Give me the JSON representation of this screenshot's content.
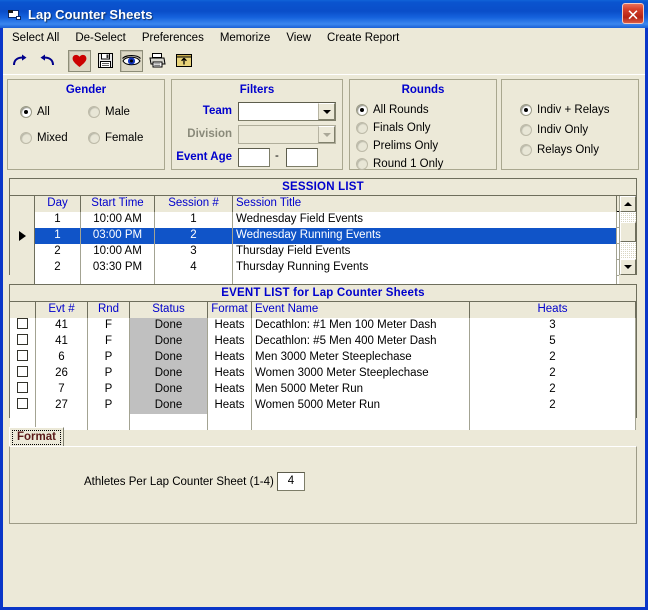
{
  "window": {
    "title": "Lap Counter Sheets",
    "close_label": "✕"
  },
  "menubar": {
    "items": [
      {
        "label": "Select All"
      },
      {
        "label": "De-Select"
      },
      {
        "label": "Preferences"
      },
      {
        "label": "Memorize"
      },
      {
        "label": "View"
      },
      {
        "label": "Create Report"
      }
    ]
  },
  "toolbar": {
    "buttons": [
      {
        "icon": "redo-arrow-icon",
        "pressed": false
      },
      {
        "icon": "undo-arrow-icon",
        "pressed": false
      },
      {
        "icon": "heart-icon",
        "pressed": true
      },
      {
        "icon": "save-floppy-icon",
        "pressed": false
      },
      {
        "icon": "eye-preview-icon",
        "pressed": true
      },
      {
        "icon": "printer-icon",
        "pressed": false
      },
      {
        "icon": "folder-up-icon",
        "pressed": false
      }
    ]
  },
  "gender": {
    "title": "Gender",
    "options": [
      {
        "label": "All",
        "selected": true
      },
      {
        "label": "Male",
        "selected": false
      },
      {
        "label": "Mixed",
        "selected": false
      },
      {
        "label": "Female",
        "selected": false
      }
    ]
  },
  "filters": {
    "title": "Filters",
    "team_label": "Team",
    "team_value": "",
    "division_label": "Division",
    "division_value": "",
    "division_disabled": true,
    "event_age_label": "Event Age",
    "event_age_from": "",
    "event_age_to": "",
    "event_age_separator": "-"
  },
  "rounds": {
    "title": "Rounds",
    "options": [
      {
        "label": "All Rounds",
        "selected": true
      },
      {
        "label": "Finals Only",
        "selected": false
      },
      {
        "label": "Prelims Only",
        "selected": false
      },
      {
        "label": "Round 1 Only",
        "selected": false
      }
    ]
  },
  "event_type": {
    "options": [
      {
        "label": "Indiv + Relays",
        "selected": true
      },
      {
        "label": "Indiv Only",
        "selected": false
      },
      {
        "label": "Relays Only",
        "selected": false
      }
    ]
  },
  "session_list": {
    "title": "SESSION LIST",
    "columns": [
      "Day",
      "Start Time",
      "Session #",
      "Session Title"
    ],
    "rows": [
      {
        "day": "1",
        "start_time": "10:00 AM",
        "session_num": "1",
        "title": "Wednesday Field Events",
        "selected": false
      },
      {
        "day": "1",
        "start_time": "03:00 PM",
        "session_num": "2",
        "title": "Wednesday Running Events",
        "selected": true
      },
      {
        "day": "2",
        "start_time": "10:00 AM",
        "session_num": "3",
        "title": "Thursday Field Events",
        "selected": false
      },
      {
        "day": "2",
        "start_time": "03:30 PM",
        "session_num": "4",
        "title": "Thursday Running Events",
        "selected": false
      }
    ]
  },
  "event_list": {
    "title": "EVENT LIST for Lap Counter Sheets",
    "columns": [
      "Evt #",
      "Rnd",
      "Status",
      "Format",
      "Event Name",
      "Heats"
    ],
    "rows": [
      {
        "checked": false,
        "evt": "41",
        "rnd": "F",
        "status": "Done",
        "format": "Heats",
        "name": "Decathlon: #1 Men 100 Meter Dash",
        "heats": "3"
      },
      {
        "checked": false,
        "evt": "41",
        "rnd": "F",
        "status": "Done",
        "format": "Heats",
        "name": "Decathlon: #5 Men 400 Meter Dash",
        "heats": "5"
      },
      {
        "checked": false,
        "evt": "6",
        "rnd": "P",
        "status": "Done",
        "format": "Heats",
        "name": "Men 3000 Meter Steeplechase",
        "heats": "2"
      },
      {
        "checked": false,
        "evt": "26",
        "rnd": "P",
        "status": "Done",
        "format": "Heats",
        "name": "Women 3000 Meter Steeplechase",
        "heats": "2"
      },
      {
        "checked": false,
        "evt": "7",
        "rnd": "P",
        "status": "Done",
        "format": "Heats",
        "name": "Men 5000 Meter Run",
        "heats": "2"
      },
      {
        "checked": false,
        "evt": "27",
        "rnd": "P",
        "status": "Done",
        "format": "Heats",
        "name": "Women 5000 Meter Run",
        "heats": "2"
      }
    ]
  },
  "tabs": {
    "items": [
      {
        "label": "Format",
        "active": true
      }
    ]
  },
  "format_page": {
    "athletes_label": "Athletes Per Lap Counter Sheet (1-4) :",
    "athletes_value": "4"
  },
  "colors": {
    "title_blue": "#0a4ec9",
    "window_border": "#0a36c8",
    "face": "#ece9d8",
    "accent_label": "#0000cc",
    "selection": "#1054c8",
    "status_cell": "#c0c0c0"
  }
}
